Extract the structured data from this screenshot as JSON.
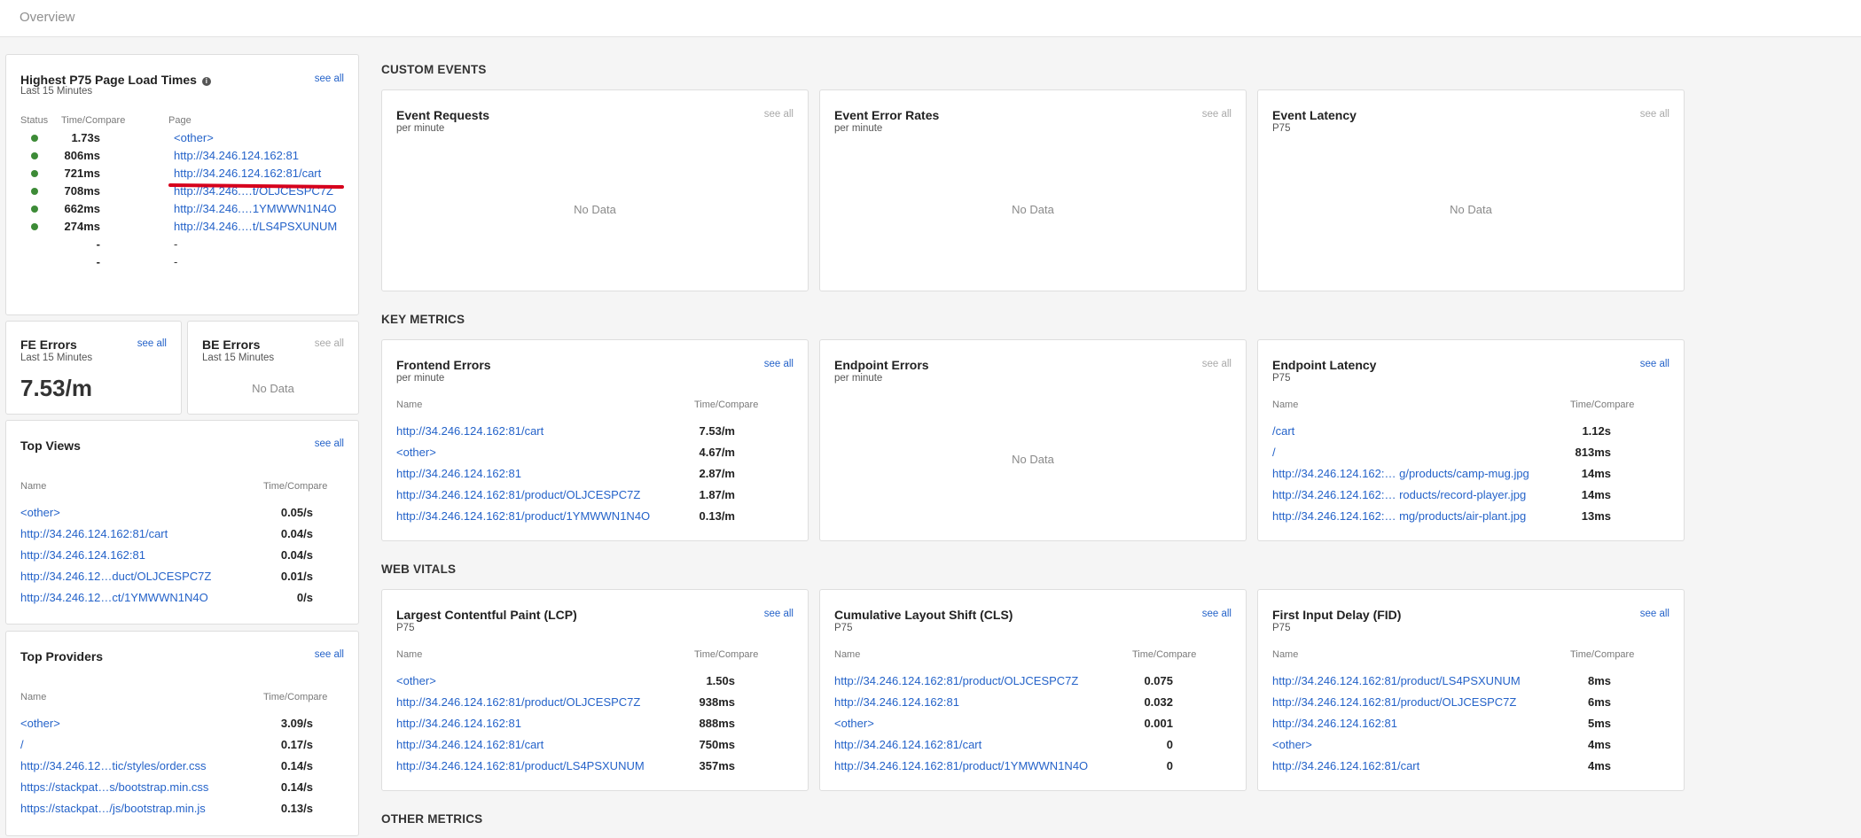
{
  "header": {
    "title": "Overview"
  },
  "see_all": "see all",
  "no_data": "No Data",
  "sections": {
    "custom_events": "CUSTOM EVENTS",
    "key_metrics": "KEY METRICS",
    "web_vitals": "WEB VITALS",
    "other_metrics": "OTHER METRICS"
  },
  "page_load": {
    "title": "Highest P75 Page Load Times",
    "subtitle": "Last 15 Minutes",
    "col_status": "Status",
    "col_time": "Time/Compare",
    "col_page": "Page",
    "rows": [
      {
        "status": "good",
        "time": "1.73s",
        "page": "<other>"
      },
      {
        "status": "good",
        "time": "806ms",
        "page": "http://34.246.124.162:81"
      },
      {
        "status": "good",
        "time": "721ms",
        "page": "http://34.246.124.162:81/cart"
      },
      {
        "status": "good",
        "time": "708ms",
        "page": "http://34.246.…t/OLJCESPC7Z"
      },
      {
        "status": "good",
        "time": "662ms",
        "page": "http://34.246.…1YMWWN1N4O"
      },
      {
        "status": "good",
        "time": "274ms",
        "page": "http://34.246.…t/LS4PSXUNUM"
      },
      {
        "status": "none",
        "time": "-",
        "page": "-"
      },
      {
        "status": "none",
        "time": "-",
        "page": "-"
      }
    ]
  },
  "fe_errors": {
    "title": "FE Errors",
    "subtitle": "Last 15 Minutes",
    "value": "7.53/m"
  },
  "be_errors": {
    "title": "BE Errors",
    "subtitle": "Last 15 Minutes"
  },
  "top_views": {
    "title": "Top Views",
    "col_name": "Name",
    "col_time": "Time/Compare",
    "rows": [
      {
        "name": "<other>",
        "value": "0.05/s"
      },
      {
        "name": "http://34.246.124.162:81/cart",
        "value": "0.04/s"
      },
      {
        "name": "http://34.246.124.162:81",
        "value": "0.04/s"
      },
      {
        "name": "http://34.246.12…duct/OLJCESPC7Z",
        "value": "0.01/s"
      },
      {
        "name": "http://34.246.12…ct/1YMWWN1N4O",
        "value": "0/s"
      }
    ]
  },
  "top_providers": {
    "title": "Top Providers",
    "col_name": "Name",
    "col_time": "Time/Compare",
    "rows": [
      {
        "name": "<other>",
        "value": "3.09/s"
      },
      {
        "name": "/",
        "value": "0.17/s"
      },
      {
        "name": "http://34.246.12…tic/styles/order.css",
        "value": "0.14/s"
      },
      {
        "name": "https://stackpat…s/bootstrap.min.css",
        "value": "0.14/s"
      },
      {
        "name": "https://stackpat…/js/bootstrap.min.js",
        "value": "0.13/s"
      }
    ]
  },
  "event_requests": {
    "title": "Event Requests",
    "subtitle": "per minute"
  },
  "event_error_rates": {
    "title": "Event Error Rates",
    "subtitle": "per minute"
  },
  "event_latency": {
    "title": "Event Latency",
    "subtitle": "P75"
  },
  "frontend_errors": {
    "title": "Frontend Errors",
    "subtitle": "per minute",
    "col_name": "Name",
    "col_time": "Time/Compare",
    "rows": [
      {
        "name": "http://34.246.124.162:81/cart",
        "value": "7.53/m"
      },
      {
        "name": "<other>",
        "value": "4.67/m"
      },
      {
        "name": "http://34.246.124.162:81",
        "value": "2.87/m"
      },
      {
        "name": "http://34.246.124.162:81/product/OLJCESPC7Z",
        "value": "1.87/m"
      },
      {
        "name": "http://34.246.124.162:81/product/1YMWWN1N4O",
        "value": "0.13/m"
      }
    ]
  },
  "endpoint_errors": {
    "title": "Endpoint Errors",
    "subtitle": "per minute"
  },
  "endpoint_latency": {
    "title": "Endpoint Latency",
    "subtitle": "P75",
    "col_name": "Name",
    "col_time": "Time/Compare",
    "rows": [
      {
        "name": "/cart",
        "value": "1.12s"
      },
      {
        "name": "/",
        "value": "813ms"
      },
      {
        "name": "http://34.246.124.162:… g/products/camp-mug.jpg",
        "value": "14ms"
      },
      {
        "name": "http://34.246.124.162:… roducts/record-player.jpg",
        "value": "14ms"
      },
      {
        "name": "http://34.246.124.162:… mg/products/air-plant.jpg",
        "value": "13ms"
      }
    ]
  },
  "lcp": {
    "title": "Largest Contentful Paint (LCP)",
    "subtitle": "P75",
    "col_name": "Name",
    "col_time": "Time/Compare",
    "rows": [
      {
        "name": "<other>",
        "value": "1.50s"
      },
      {
        "name": "http://34.246.124.162:81/product/OLJCESPC7Z",
        "value": "938ms"
      },
      {
        "name": "http://34.246.124.162:81",
        "value": "888ms"
      },
      {
        "name": "http://34.246.124.162:81/cart",
        "value": "750ms"
      },
      {
        "name": "http://34.246.124.162:81/product/LS4PSXUNUM",
        "value": "357ms"
      }
    ]
  },
  "cls": {
    "title": "Cumulative Layout Shift (CLS)",
    "subtitle": "P75",
    "col_name": "Name",
    "col_time": "Time/Compare",
    "rows": [
      {
        "name": "http://34.246.124.162:81/product/OLJCESPC7Z",
        "value": "0.075"
      },
      {
        "name": "http://34.246.124.162:81",
        "value": "0.032"
      },
      {
        "name": "<other>",
        "value": "0.001"
      },
      {
        "name": "http://34.246.124.162:81/cart",
        "value": "0"
      },
      {
        "name": "http://34.246.124.162:81/product/1YMWWN1N4O",
        "value": "0"
      }
    ]
  },
  "fid": {
    "title": "First Input Delay (FID)",
    "subtitle": "P75",
    "col_name": "Name",
    "col_time": "Time/Compare",
    "rows": [
      {
        "name": "http://34.246.124.162:81/product/LS4PSXUNUM",
        "value": "8ms"
      },
      {
        "name": "http://34.246.124.162:81/product/OLJCESPC7Z",
        "value": "6ms"
      },
      {
        "name": "http://34.246.124.162:81",
        "value": "5ms"
      },
      {
        "name": "<other>",
        "value": "4ms"
      },
      {
        "name": "http://34.246.124.162:81/cart",
        "value": "4ms"
      }
    ]
  },
  "colors": {
    "link": "#2563c9",
    "status_good": "#3d8b37",
    "annotation": "#d6001c"
  }
}
